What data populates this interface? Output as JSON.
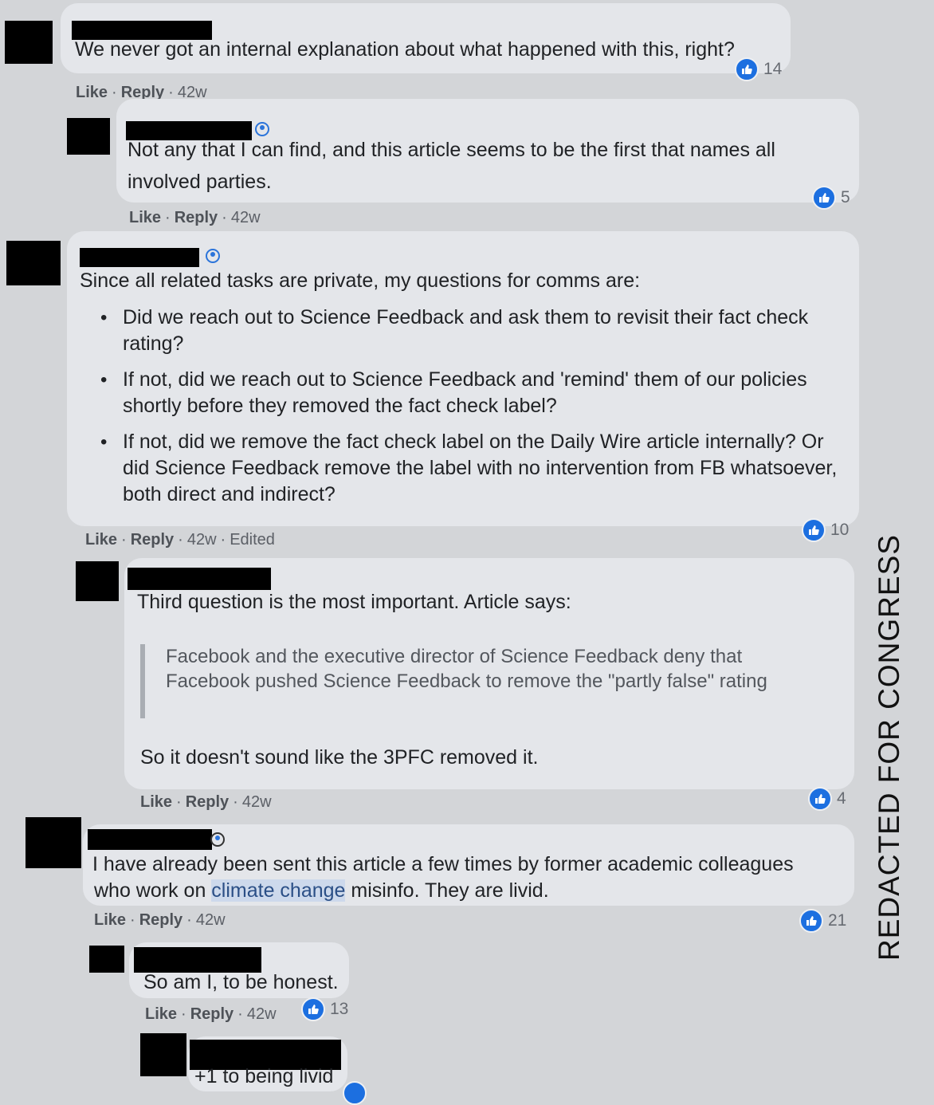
{
  "watermark": "REDACTED FOR CONGRESS",
  "actions": {
    "like": "Like",
    "reply": "Reply",
    "dot": "·"
  },
  "comments": [
    {
      "text": "We never got an internal explanation about what happened with this, right?",
      "time": "42w",
      "reactions": "14"
    },
    {
      "text_lines": [
        "Not any that I can find, and this article seems to be the first that names all",
        "involved parties."
      ],
      "time": "42w",
      "reactions": "5"
    },
    {
      "intro": "Since all related tasks are private, my questions for comms are:",
      "bullets": [
        "Did we reach out to Science Feedback and ask them to revisit their fact check rating?",
        "If not, did we reach out to Science Feedback and 'remind' them of our policies shortly before they removed the fact check label?",
        "If not, did we remove the fact check label on the Daily Wire article internally? Or did Science Feedback remove the label with no intervention from FB whatsoever, both direct and indirect?"
      ],
      "time": "42w",
      "edited": "Edited",
      "reactions": "10"
    },
    {
      "text": "Third question is the most important. Article says:",
      "quote": "Facebook and the executive director of Science Feedback deny that Facebook pushed Science Feedback to remove the \"partly false\" rating",
      "followup": "So it doesn't sound like the 3PFC removed it.",
      "time": "42w",
      "reactions": "4"
    },
    {
      "line1": "I have already been sent this article a few times by former academic colleagues",
      "line2_pre": "who work on ",
      "line2_link": "climate change",
      "line2_post": " misinfo. They are livid.",
      "time": "42w",
      "reactions": "21"
    },
    {
      "text": "So am I, to be honest.",
      "time": "42w",
      "reactions": "13"
    },
    {
      "text": "+1 to being livid"
    }
  ]
}
